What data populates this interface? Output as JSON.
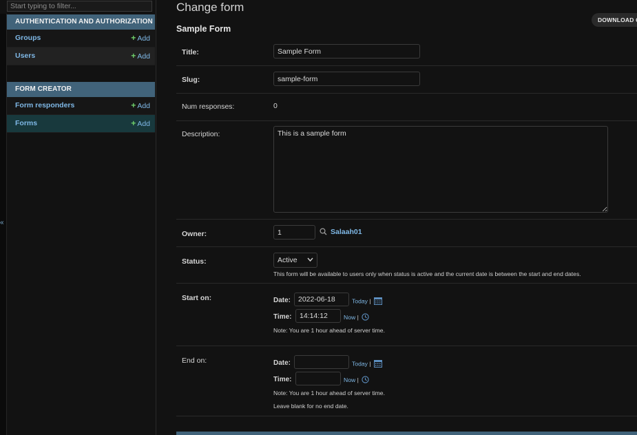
{
  "sidebar": {
    "filter_placeholder": "Start typing to filter...",
    "toggle_glyph": "«",
    "modules": [
      {
        "caption": "AUTHENTICATION AND AUTHORIZATION",
        "items": [
          {
            "label": "Groups",
            "add": "Add"
          },
          {
            "label": "Users",
            "add": "Add"
          }
        ]
      },
      {
        "caption": "FORM CREATOR",
        "items": [
          {
            "label": "Form responders",
            "add": "Add"
          },
          {
            "label": "Forms",
            "add": "Add",
            "current": true
          }
        ]
      }
    ]
  },
  "main": {
    "page_title": "Change form",
    "download_button": "DOWNLOAD CSV",
    "form_heading": "Sample Form",
    "fields": {
      "title": {
        "label": "Title:",
        "value": "Sample Form"
      },
      "slug": {
        "label": "Slug:",
        "value": "sample-form"
      },
      "num_responses": {
        "label": "Num responses:",
        "value": "0"
      },
      "description": {
        "label": "Description:",
        "value": "This is a sample form"
      },
      "owner": {
        "label": "Owner:",
        "value": "1",
        "linked_name": "Salaah01",
        "lookup_icon": "search-icon"
      },
      "status": {
        "label": "Status:",
        "value": "Active",
        "help": "This form will be available to users only when status is active and the current date is between the start and end dates."
      },
      "start_on": {
        "label": "Start on:",
        "date_label": "Date:",
        "date_value": "2022-06-18",
        "today": "Today",
        "sep": "|",
        "time_label": "Time:",
        "time_value": "14:14:12",
        "now": "Now",
        "note": "Note: You are 1 hour ahead of server time."
      },
      "end_on": {
        "label": "End on:",
        "date_label": "Date:",
        "date_value": "",
        "today": "Today",
        "sep": "|",
        "time_label": "Time:",
        "time_value": "",
        "now": "Now",
        "note": "Note: You are 1 hour ahead of server time.",
        "help": "Leave blank for no end date."
      }
    }
  },
  "colors": {
    "background": "#121212",
    "module_caption": "#41637a",
    "link": "#7fb8e6",
    "add_plus": "#6fcf6a",
    "current_row": "#18393d"
  }
}
